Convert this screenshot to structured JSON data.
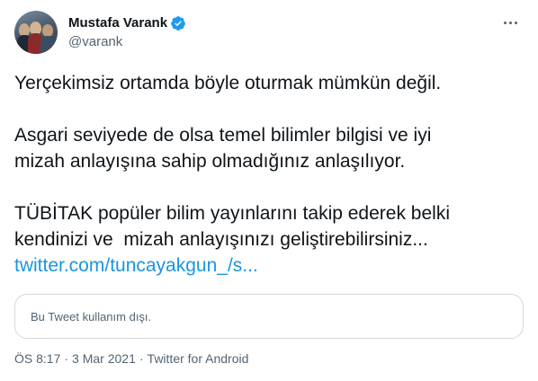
{
  "author": {
    "display_name": "Mustafa Varank",
    "handle": "@varank",
    "verified": true,
    "verified_color": "#1d9bf0"
  },
  "tweet": {
    "paragraph_1": "Yerçekimsiz ortamda böyle oturmak mümkün değil.",
    "paragraph_2_line_1": "Asgari seviyede de olsa temel bilimler bilgisi ve iyi",
    "paragraph_2_line_2": "mizah anlayışına sahip olmadığınız anlaşılıyor.",
    "paragraph_3_line_1": "TÜBİTAK popüler bilim yayınlarını takip ederek belki",
    "paragraph_3_line_2": "kendinizi ve  mizah anlayışınızı geliştirebilirsiniz...",
    "link_text": "twitter.com/tuncayakgun_/s...",
    "link_color": "#1b95e0"
  },
  "quoted_tweet": {
    "notice": "Bu Tweet kullanım dışı."
  },
  "meta": {
    "time": "ÖS 8:17",
    "separator": "·",
    "date": "3 Mar 2021",
    "source": "Twitter for Android"
  },
  "icons": {
    "more": "more-horizontal-icon",
    "verified": "verified-badge-icon"
  }
}
